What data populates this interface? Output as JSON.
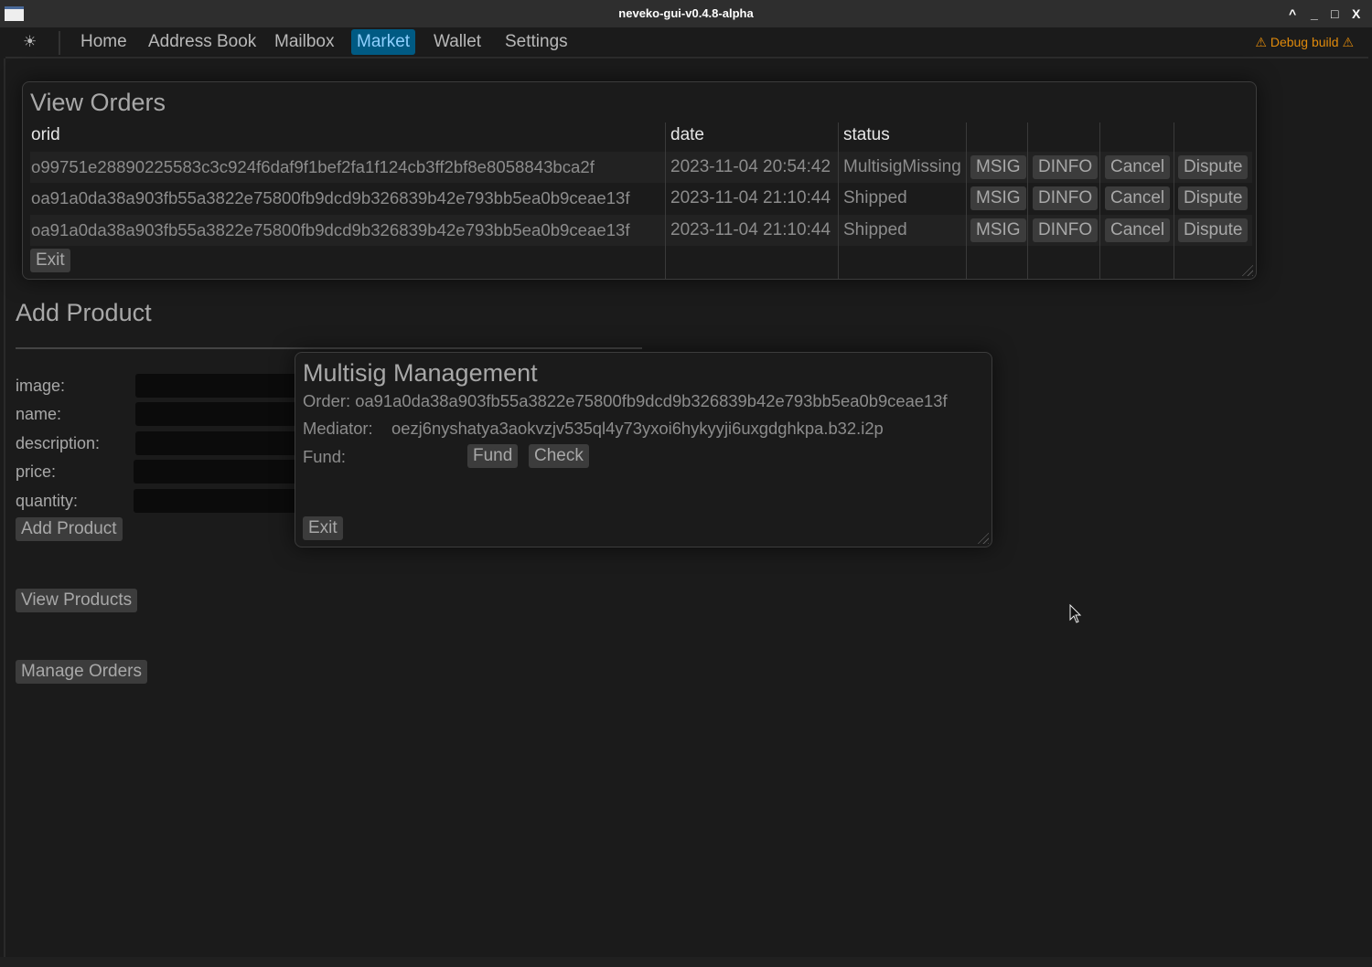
{
  "window": {
    "title": "neveko-gui-v0.4.8-alpha",
    "controls": [
      "^",
      "_",
      "□",
      "X"
    ]
  },
  "menu": {
    "theme_icon": "☀",
    "items": [
      "Home",
      "Address Book",
      "Mailbox",
      "Market",
      "Wallet",
      "Settings"
    ],
    "active": "Market",
    "debug": "⚠ Debug build ⚠"
  },
  "view_orders": {
    "title": "View Orders",
    "headers": [
      "orid",
      "date",
      "status"
    ],
    "rows": [
      {
        "orid": "o99751e28890225583c3c924f6daf9f1bef2fa1f124cb3ff2bf8e8058843bca2f",
        "date": "2023-11-04 20:54:42",
        "status": "MultisigMissing"
      },
      {
        "orid": "oa91a0da38a903fb55a3822e75800fb9dcd9b326839b42e793bb5ea0b9ceae13f",
        "date": "2023-11-04 21:10:44",
        "status": "Shipped"
      },
      {
        "orid": "oa91a0da38a903fb55a3822e75800fb9dcd9b326839b42e793bb5ea0b9ceae13f",
        "date": "2023-11-04 21:10:44",
        "status": "Shipped"
      }
    ],
    "actions": [
      "MSIG",
      "DINFO",
      "Cancel",
      "Dispute"
    ],
    "exit": "Exit"
  },
  "add_product": {
    "title": "Add Product",
    "fields": [
      "image:",
      "name:",
      "description:",
      "price:",
      "quantity:"
    ],
    "submit": "Add Product"
  },
  "view_products": "View Products",
  "manage_orders": "Manage Orders",
  "multisig": {
    "title": "Multisig Management",
    "order": "Order: oa91a0da38a903fb55a3822e75800fb9dcd9b326839b42e793bb5ea0b9ceae13f",
    "mediator_label": "Mediator:",
    "mediator": "oezj6nyshatya3aokvzjv535ql4y73yxoi6hykyyji6uxgdghkpa.b32.i2p",
    "fund_label": "Fund:",
    "fund": "Fund",
    "check": "Check",
    "exit": "Exit"
  },
  "colors": {
    "accent": "#005a83",
    "warning": "#e08a0b"
  }
}
